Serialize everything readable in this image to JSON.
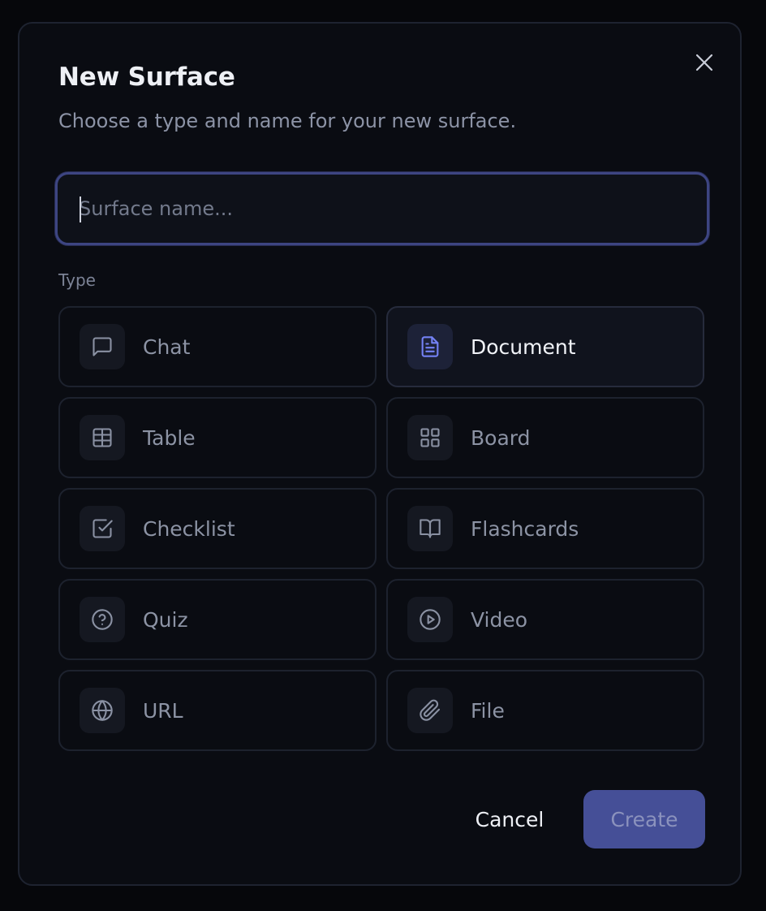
{
  "dialog": {
    "title": "New Surface",
    "subtitle": "Choose a type and name for your new surface.",
    "name_placeholder": "Surface name...",
    "name_value": "",
    "type_label": "Type",
    "selected_type": "Document",
    "types": [
      {
        "label": "Chat",
        "icon": "message-square-icon"
      },
      {
        "label": "Document",
        "icon": "file-text-icon"
      },
      {
        "label": "Table",
        "icon": "table-icon"
      },
      {
        "label": "Board",
        "icon": "grid-icon"
      },
      {
        "label": "Checklist",
        "icon": "check-square-icon"
      },
      {
        "label": "Flashcards",
        "icon": "book-open-icon"
      },
      {
        "label": "Quiz",
        "icon": "help-circle-icon"
      },
      {
        "label": "Video",
        "icon": "play-circle-icon"
      },
      {
        "label": "URL",
        "icon": "globe-icon"
      },
      {
        "label": "File",
        "icon": "paperclip-icon"
      }
    ],
    "cancel_label": "Cancel",
    "create_label": "Create"
  },
  "colors": {
    "accent": "#6e7cf0",
    "create_button": "#454f97",
    "background": "#0a0c12"
  }
}
